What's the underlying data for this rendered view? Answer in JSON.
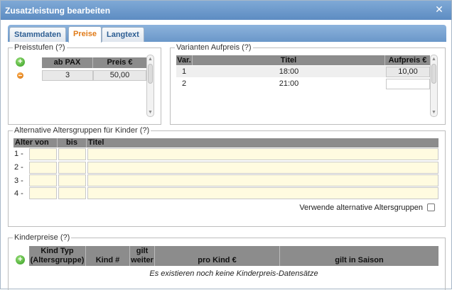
{
  "window": {
    "title": "Zusatzleistung bearbeiten"
  },
  "tabs": [
    {
      "label": "Stammdaten"
    },
    {
      "label": "Preise"
    },
    {
      "label": "Langtext"
    }
  ],
  "preisstufen": {
    "legend": "Preisstufen (?)",
    "headers": [
      "ab PAX",
      "Preis €"
    ],
    "rows": [
      {
        "ab_pax": "3",
        "preis": "50,00"
      }
    ]
  },
  "varianten": {
    "legend": "Varianten Aufpreis (?)",
    "headers": [
      "Var.",
      "Titel",
      "Aufpreis €"
    ],
    "rows": [
      {
        "var": "1",
        "titel": "18:00",
        "aufpreis": "10,00"
      },
      {
        "var": "2",
        "titel": "21:00",
        "aufpreis": ""
      }
    ]
  },
  "altersgruppen": {
    "legend": "Alternative Altersgruppen für Kinder (?)",
    "headers": [
      "Alter von",
      "bis",
      "Titel"
    ],
    "rows": [
      {
        "label": "1 -"
      },
      {
        "label": "2 -"
      },
      {
        "label": "3 -"
      },
      {
        "label": "4 -"
      }
    ],
    "checkbox_label": "Verwende alternative Altersgruppen"
  },
  "kinderpreise": {
    "legend": "Kinderpreise (?)",
    "headers": {
      "kind_typ_1": "Kind Typ",
      "kind_typ_2": "(Altersgruppe)",
      "kind_nr": "Kind #",
      "gilt_1": "gilt",
      "gilt_2": "weiter",
      "pro_kind": "pro Kind €",
      "saison": "gilt in Saison"
    },
    "empty_text": "Es existieren noch keine Kinderpreis-Datensätze"
  },
  "icons": {
    "close": "close-icon",
    "add": "plus-icon",
    "remove": "minus-icon"
  },
  "colors": {
    "titlebar": "#6a97c9",
    "active_tab_text": "#e07b19",
    "tab_text": "#2d5e93",
    "input_bg": "#fffbe0",
    "header_bg": "#8c8c8c"
  }
}
